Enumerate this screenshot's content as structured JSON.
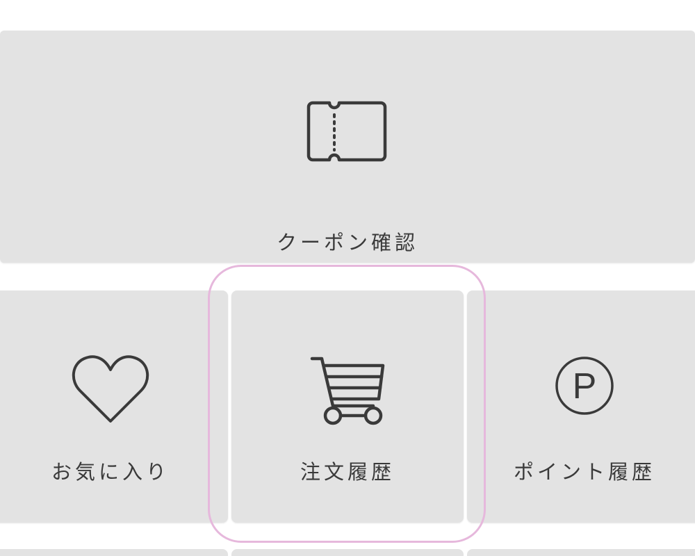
{
  "colors": {
    "tile_background": "#e3e3e3",
    "icon_stroke": "#3a3a3a",
    "label_text": "#3a3a3a",
    "highlight": "#e6b8dc"
  },
  "menu": {
    "coupon": {
      "label": "クーポン確認",
      "icon": "ticket-icon"
    },
    "favorites": {
      "label": "お気に入り",
      "icon": "heart-icon"
    },
    "orders": {
      "label": "注文履歴",
      "icon": "cart-icon"
    },
    "points": {
      "label": "ポイント履歴",
      "icon": "points-icon",
      "icon_glyph": "P"
    }
  }
}
